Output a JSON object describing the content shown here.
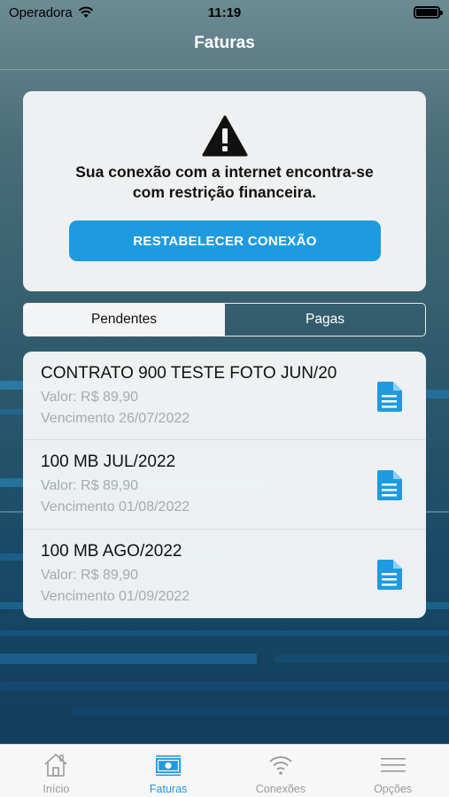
{
  "status_bar": {
    "carrier": "Operadora",
    "time": "11:19"
  },
  "header": {
    "title": "Faturas"
  },
  "warning": {
    "message_line1": "Sua conexão com a internet encontra-se",
    "message_line2": "com restrição financeira.",
    "button_label": "RESTABELECER CONEXÃO",
    "icon": "warning-icon"
  },
  "segments": [
    {
      "label": "Pendentes",
      "selected": true
    },
    {
      "label": "Pagas",
      "selected": false
    }
  ],
  "invoices": [
    {
      "title": "CONTRATO 900 TESTE FOTO JUN/20",
      "value": "Valor: R$ 89,90",
      "due": "Vencimento 26/07/2022"
    },
    {
      "title": "100 MB JUL/2022",
      "value": "Valor: R$ 89,90",
      "due": "Vencimento 01/08/2022"
    },
    {
      "title": "100 MB AGO/2022",
      "value": "Valor: R$ 89,90",
      "due": "Vencimento 01/09/2022"
    }
  ],
  "tabs": [
    {
      "label": "Início",
      "icon": "home-icon",
      "active": false
    },
    {
      "label": "Faturas",
      "icon": "invoice-money-icon",
      "active": true
    },
    {
      "label": "Conexões",
      "icon": "wifi-icon",
      "active": false
    },
    {
      "label": "Opções",
      "icon": "menu-icon",
      "active": false
    }
  ],
  "colors": {
    "accent": "#1e9be0",
    "card_bg": "#eef0f1",
    "inactive_tab": "#9a9a9a"
  }
}
